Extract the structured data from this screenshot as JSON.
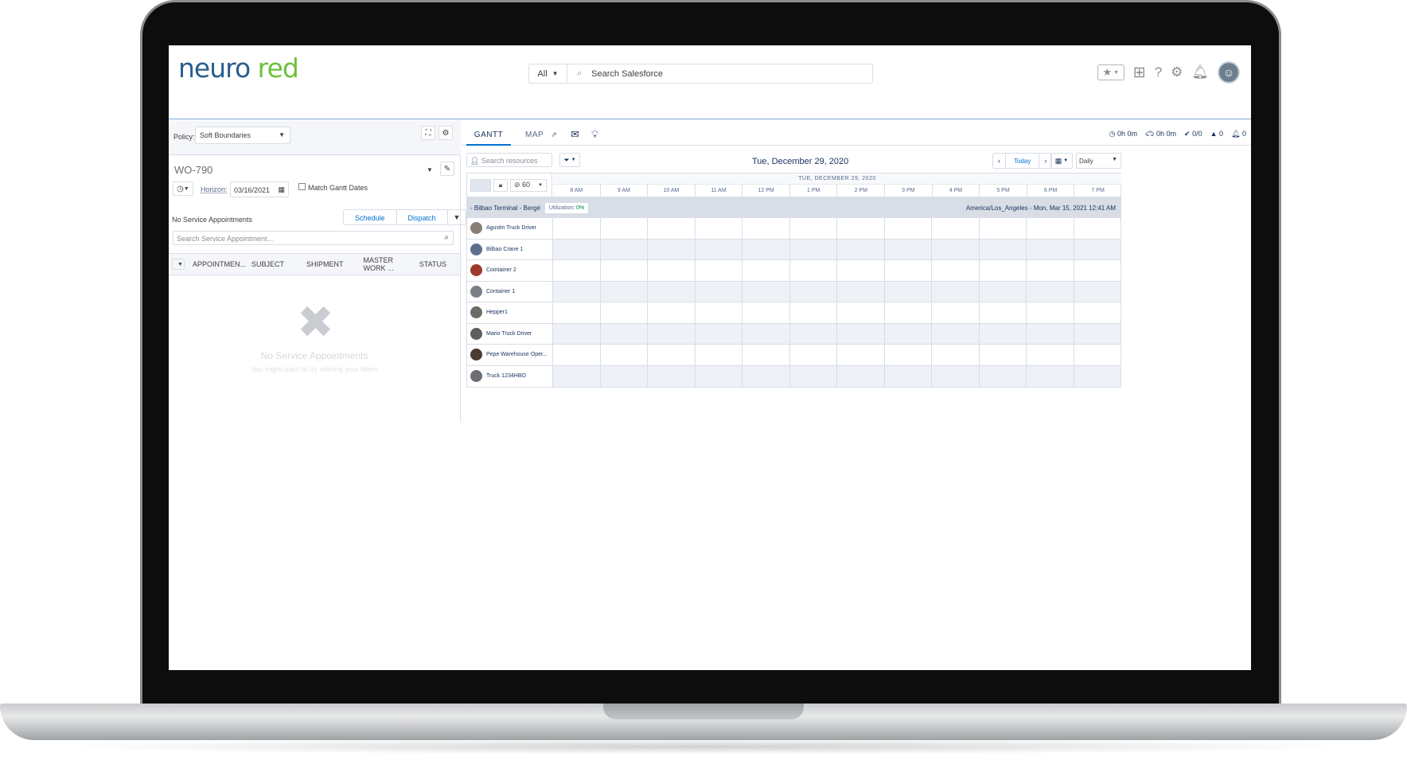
{
  "header": {
    "logo_part1": "neuro",
    "logo_part2": "red",
    "search_scope": "All",
    "search_placeholder": "Search Salesforce",
    "icons": [
      "favorites-star-icon",
      "add-icon",
      "help-icon",
      "setup-gear-icon",
      "notification-bell-icon",
      "user-avatar"
    ]
  },
  "left": {
    "policy_label": "Policy:",
    "policy_value": "Soft Boundaries",
    "work_order": "WO-790",
    "horizon_label": "Horizon:",
    "horizon_date": "03/16/2021",
    "match_label": "Match Gantt Dates",
    "no_sa_label": "No Service Appointments",
    "schedule_label": "Schedule",
    "dispatch_label": "Dispatch",
    "sa_search_placeholder": "Search Service Appointment...",
    "columns": [
      "APPOINTMEN...",
      "SUBJECT",
      "SHIPMENT",
      "MASTER WORK ...",
      "STATUS"
    ],
    "empty_title": "No Service Appointments",
    "empty_sub": "You might want to try refining your filters"
  },
  "right": {
    "tabs": [
      "GANTT",
      "MAP"
    ],
    "stats": {
      "time1": "0h 0m",
      "time2": "0h 0m",
      "check": "0/0",
      "alert": "0",
      "bell": "0"
    },
    "res_search_placeholder": "Search resources",
    "date_title": "Tue, December 29, 2020",
    "today_label": "Today",
    "view_value": "Daily",
    "gantt": {
      "interval": "60",
      "day_label": "TUE, DECEMBER 29, 2020",
      "hours": [
        "8 AM",
        "9 AM",
        "10 AM",
        "11 AM",
        "12 PM",
        "1 PM",
        "2 PM",
        "3 PM",
        "4 PM",
        "5 PM",
        "6 PM",
        "7 PM"
      ],
      "group_name": "- Bilbao Terminal - Bergé",
      "utilization_label": "Utilization:",
      "utilization_value": "0%",
      "timezone": "America/Los_Angeles - Mon, Mar 15, 2021 12:41 AM",
      "resources": [
        {
          "name": "Agustin Truck Driver",
          "color": "#8a7f76"
        },
        {
          "name": "Bilbao Crane 1",
          "color": "#5a6f8c"
        },
        {
          "name": "Cointainer 2",
          "color": "#9c3a2e"
        },
        {
          "name": "Container 1",
          "color": "#7b7e84"
        },
        {
          "name": "Hepper1",
          "color": "#6e6a66"
        },
        {
          "name": "Mario Truck Driver",
          "color": "#5d5d60"
        },
        {
          "name": "Pepe Warehouse Oper...",
          "color": "#4a3b33"
        },
        {
          "name": "Truck 1234HBO",
          "color": "#6c6f73"
        }
      ]
    }
  }
}
